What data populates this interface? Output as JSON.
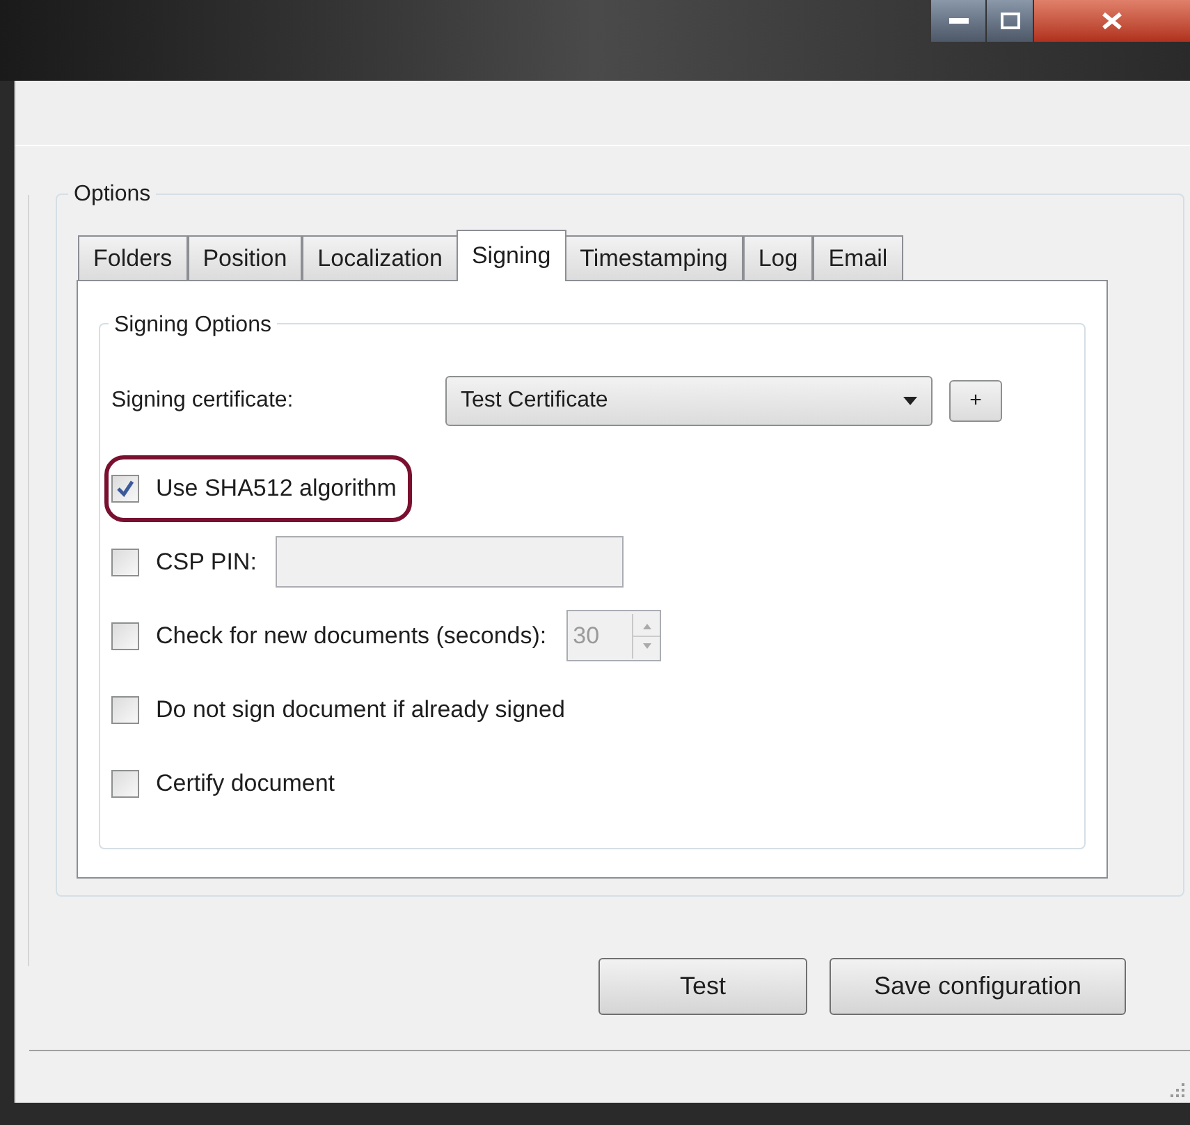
{
  "options_group": {
    "title": "Options"
  },
  "tabs": [
    {
      "label": "Folders",
      "selected": false
    },
    {
      "label": "Position",
      "selected": false
    },
    {
      "label": "Localization",
      "selected": false
    },
    {
      "label": "Signing",
      "selected": true
    },
    {
      "label": "Timestamping",
      "selected": false
    },
    {
      "label": "Log",
      "selected": false
    },
    {
      "label": "Email",
      "selected": false
    }
  ],
  "signing_group": {
    "title": "Signing Options",
    "certificate": {
      "label": "Signing certificate:",
      "value": "Test Certificate",
      "add_button": "+"
    },
    "options": [
      {
        "kind": "plain",
        "label": "Use SHA512 algorithm",
        "checked": true,
        "highlighted": true
      },
      {
        "kind": "field",
        "label": "CSP PIN:",
        "checked": false,
        "highlighted": false
      },
      {
        "kind": "spinner",
        "label": "Check for new documents (seconds):",
        "checked": false,
        "highlighted": false,
        "value": "30"
      },
      {
        "kind": "plain",
        "label": "Do not sign document if already signed",
        "checked": false,
        "highlighted": false
      },
      {
        "kind": "plain",
        "label": "Certify document",
        "checked": false,
        "highlighted": false
      }
    ]
  },
  "buttons": [
    {
      "label": "Test"
    },
    {
      "label": "Save configuration"
    }
  ]
}
